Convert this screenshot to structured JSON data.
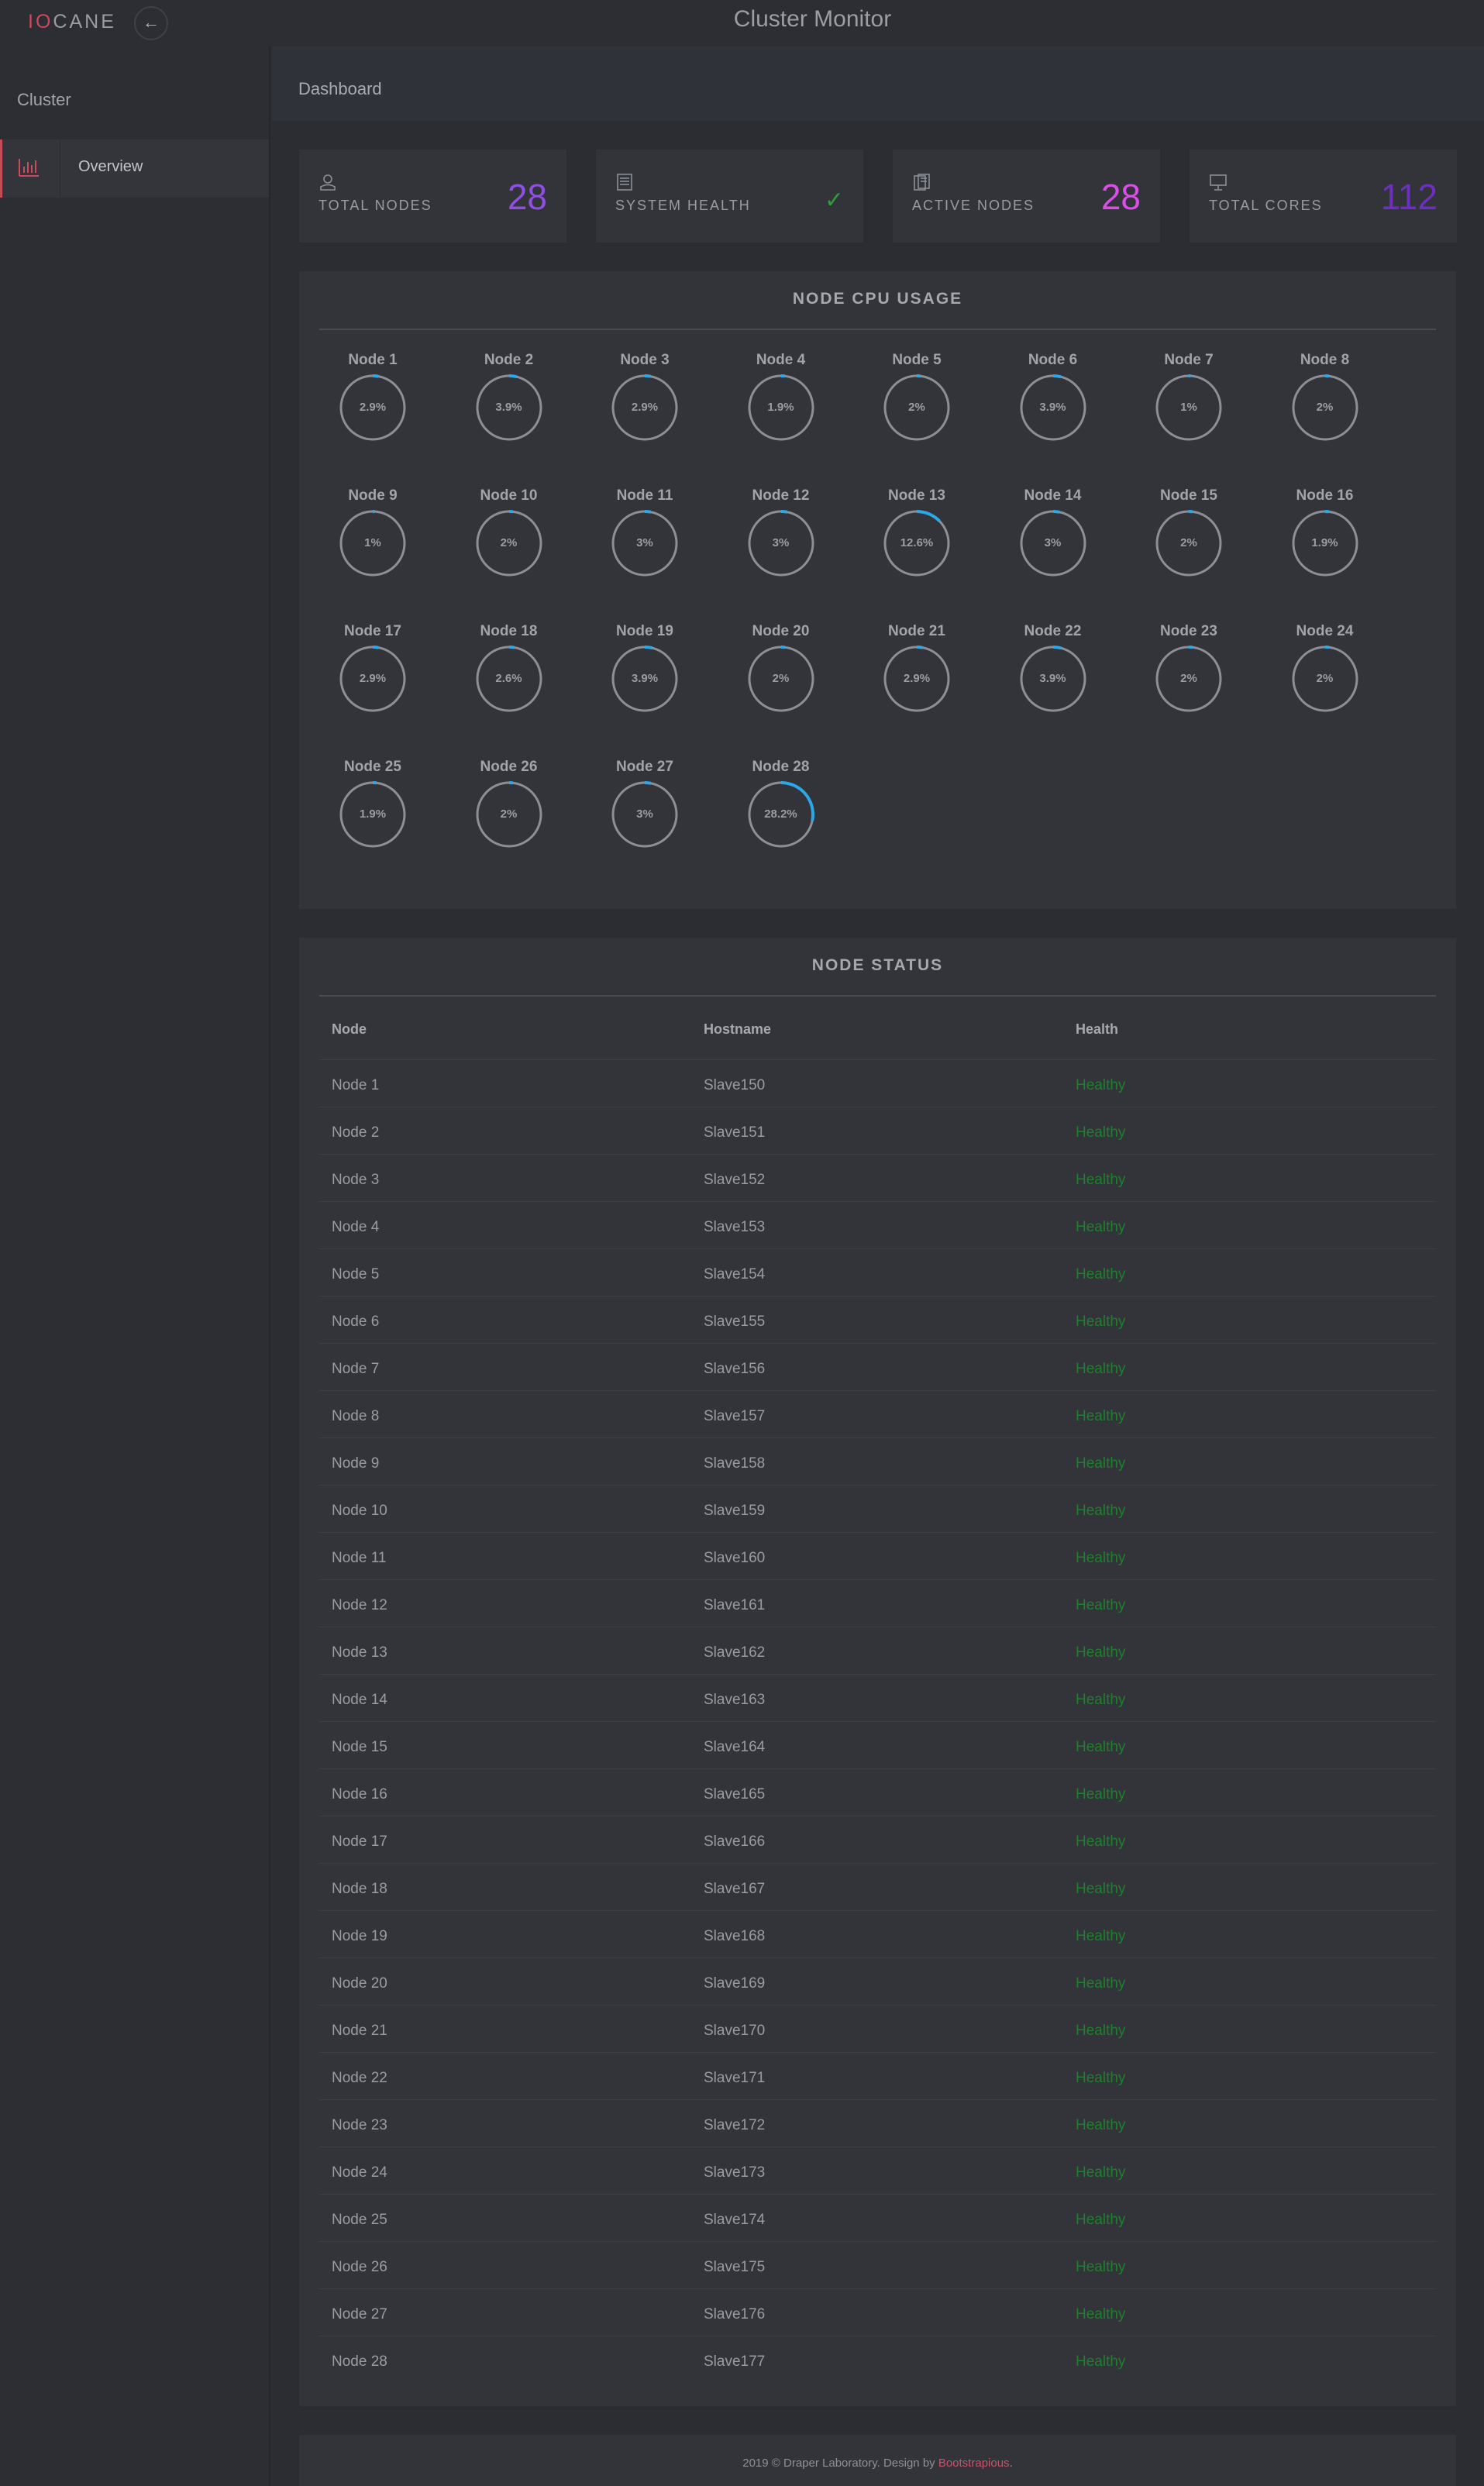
{
  "topbar": {
    "brand_prefix": "IO",
    "brand_suffix": "CANE",
    "title": "Cluster Monitor"
  },
  "sidebar": {
    "heading": "Cluster",
    "items": [
      {
        "label": "Overview",
        "icon": "bar-chart-icon"
      }
    ]
  },
  "main": {
    "title": "Dashboard"
  },
  "stats": [
    {
      "label": "TOTAL NODES",
      "value": "28",
      "icon": "user-icon",
      "color": "#8f4fe0"
    },
    {
      "label": "SYSTEM HEALTH",
      "value": "✓",
      "icon": "server-icon",
      "color": "#2f9b3b"
    },
    {
      "label": "ACTIVE NODES",
      "value": "28",
      "icon": "servers-icon",
      "color": "#d94fe8"
    },
    {
      "label": "TOTAL CORES",
      "value": "112",
      "icon": "monitor-icon",
      "color": "#6d2fbf"
    }
  ],
  "cpu_panel": {
    "title": "NODE CPU USAGE",
    "nodes": [
      {
        "name": "Node 1",
        "label": "2.9%",
        "value": 2.9
      },
      {
        "name": "Node 2",
        "label": "3.9%",
        "value": 3.9
      },
      {
        "name": "Node 3",
        "label": "2.9%",
        "value": 2.9
      },
      {
        "name": "Node 4",
        "label": "1.9%",
        "value": 1.9
      },
      {
        "name": "Node 5",
        "label": "2%",
        "value": 2
      },
      {
        "name": "Node 6",
        "label": "3.9%",
        "value": 3.9
      },
      {
        "name": "Node 7",
        "label": "1%",
        "value": 1
      },
      {
        "name": "Node 8",
        "label": "2%",
        "value": 2
      },
      {
        "name": "Node 9",
        "label": "1%",
        "value": 1
      },
      {
        "name": "Node 10",
        "label": "2%",
        "value": 2
      },
      {
        "name": "Node 11",
        "label": "3%",
        "value": 3
      },
      {
        "name": "Node 12",
        "label": "3%",
        "value": 3
      },
      {
        "name": "Node 13",
        "label": "12.6%",
        "value": 12.6
      },
      {
        "name": "Node 14",
        "label": "3%",
        "value": 3
      },
      {
        "name": "Node 15",
        "label": "2%",
        "value": 2
      },
      {
        "name": "Node 16",
        "label": "1.9%",
        "value": 1.9
      },
      {
        "name": "Node 17",
        "label": "2.9%",
        "value": 2.9
      },
      {
        "name": "Node 18",
        "label": "2.6%",
        "value": 2.6
      },
      {
        "name": "Node 19",
        "label": "3.9%",
        "value": 3.9
      },
      {
        "name": "Node 20",
        "label": "2%",
        "value": 2
      },
      {
        "name": "Node 21",
        "label": "2.9%",
        "value": 2.9
      },
      {
        "name": "Node 22",
        "label": "3.9%",
        "value": 3.9
      },
      {
        "name": "Node 23",
        "label": "2%",
        "value": 2
      },
      {
        "name": "Node 24",
        "label": "2%",
        "value": 2
      },
      {
        "name": "Node 25",
        "label": "1.9%",
        "value": 1.9
      },
      {
        "name": "Node 26",
        "label": "2%",
        "value": 2
      },
      {
        "name": "Node 27",
        "label": "3%",
        "value": 3
      },
      {
        "name": "Node 28",
        "label": "28.2%",
        "value": 28.2
      }
    ],
    "ring_color": "#8d8f96",
    "arc_color": "#2aa8e8"
  },
  "status_panel": {
    "title": "NODE STATUS",
    "columns": [
      "Node",
      "Hostname",
      "Health"
    ],
    "rows": [
      [
        "Node 1",
        "Slave150",
        "Healthy"
      ],
      [
        "Node 2",
        "Slave151",
        "Healthy"
      ],
      [
        "Node 3",
        "Slave152",
        "Healthy"
      ],
      [
        "Node 4",
        "Slave153",
        "Healthy"
      ],
      [
        "Node 5",
        "Slave154",
        "Healthy"
      ],
      [
        "Node 6",
        "Slave155",
        "Healthy"
      ],
      [
        "Node 7",
        "Slave156",
        "Healthy"
      ],
      [
        "Node 8",
        "Slave157",
        "Healthy"
      ],
      [
        "Node 9",
        "Slave158",
        "Healthy"
      ],
      [
        "Node 10",
        "Slave159",
        "Healthy"
      ],
      [
        "Node 11",
        "Slave160",
        "Healthy"
      ],
      [
        "Node 12",
        "Slave161",
        "Healthy"
      ],
      [
        "Node 13",
        "Slave162",
        "Healthy"
      ],
      [
        "Node 14",
        "Slave163",
        "Healthy"
      ],
      [
        "Node 15",
        "Slave164",
        "Healthy"
      ],
      [
        "Node 16",
        "Slave165",
        "Healthy"
      ],
      [
        "Node 17",
        "Slave166",
        "Healthy"
      ],
      [
        "Node 18",
        "Slave167",
        "Healthy"
      ],
      [
        "Node 19",
        "Slave168",
        "Healthy"
      ],
      [
        "Node 20",
        "Slave169",
        "Healthy"
      ],
      [
        "Node 21",
        "Slave170",
        "Healthy"
      ],
      [
        "Node 22",
        "Slave171",
        "Healthy"
      ],
      [
        "Node 23",
        "Slave172",
        "Healthy"
      ],
      [
        "Node 24",
        "Slave173",
        "Healthy"
      ],
      [
        "Node 25",
        "Slave174",
        "Healthy"
      ],
      [
        "Node 26",
        "Slave175",
        "Healthy"
      ],
      [
        "Node 27",
        "Slave176",
        "Healthy"
      ],
      [
        "Node 28",
        "Slave177",
        "Healthy"
      ]
    ]
  },
  "footer": {
    "text": "2019 © Draper Laboratory. Design by ",
    "credit": "Bootstrapious",
    "end": "."
  }
}
